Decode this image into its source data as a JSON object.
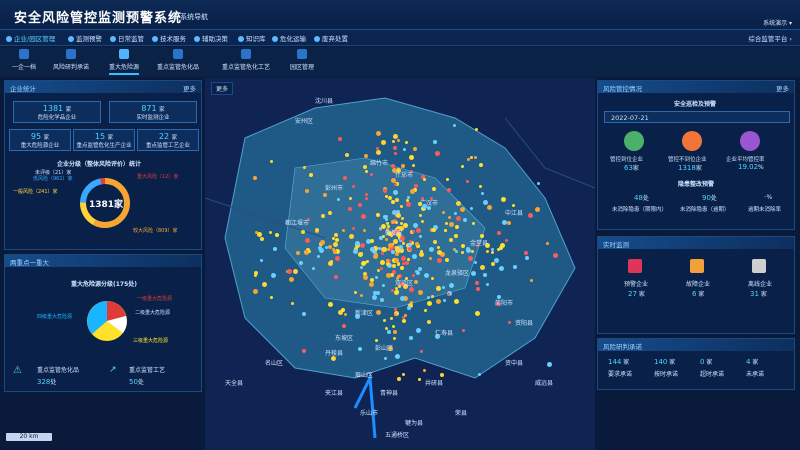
{
  "header": {
    "title": "安全风险管控监测预警系统",
    "nav": "系统导航",
    "user": "系统演示 ▾"
  },
  "menu": {
    "items": [
      "企业/园区管理",
      "监测预警",
      "日常监管",
      "技术服务",
      "辅助决策",
      "知识库",
      "危化运输",
      "废弃处置"
    ],
    "right": "综合监管平台 ›"
  },
  "tabs": [
    "一企一档",
    "风险研判承诺",
    "重大危险源",
    "重点监管危化品",
    "重点监管危化工艺",
    "园区管理"
  ],
  "left_top": {
    "title": "企业统计",
    "more": "更多",
    "stats": [
      {
        "n": "1381",
        "u": "家",
        "l": "危险化学品企业"
      },
      {
        "n": "871",
        "u": "家",
        "l": "实时监测企业"
      },
      {
        "n": "95",
        "u": "家",
        "l": "重大危险源企业"
      },
      {
        "n": "15",
        "u": "家",
        "l": "重点监管危化生产企业"
      },
      {
        "n": "22",
        "u": "家",
        "l": "重点监管工艺企业"
      }
    ],
    "chart_title": "企业分级（整体风险评价）统计",
    "center": "1381家",
    "legend": [
      "未评级（21）家",
      "低风险（961）家",
      "一般风险（241）家",
      "重大风险（12）家",
      "较大风险（809）家"
    ]
  },
  "left_bottom": {
    "title": "两重点一重大",
    "chart_title": "重大危险源分级(175处)",
    "legend": [
      "一级重大危险源",
      "二级重大危险源",
      "三级重大危险源",
      "四级重大危险源"
    ],
    "foot": [
      {
        "l": "重点监管危化品",
        "n": "328",
        "u": "处"
      },
      {
        "l": "重点监管工艺",
        "n": "50",
        "u": "处"
      }
    ]
  },
  "map": {
    "more": "更多",
    "scale": "20 km",
    "places": [
      "沈川县",
      "安州区",
      "绵竹市",
      "什邡市",
      "广汉市",
      "彭州市",
      "都江堰市",
      "新都区",
      "金堂县",
      "龙泉驿区",
      "简阳市",
      "双流区",
      "新津区",
      "仁寿县",
      "彭山区",
      "眉山区",
      "丹棱县",
      "青神县",
      "夹江县",
      "乐山市",
      "中江县",
      "资阳县",
      "资中县",
      "井研县",
      "荣县",
      "犍为县",
      "五通桥区",
      "威远县",
      "天全县",
      "名山区",
      "东坡区"
    ]
  },
  "right_top": {
    "title": "风险管控情况",
    "more": "更多",
    "sub": "安全巡检及预警",
    "date": "2022-07-21",
    "items": [
      {
        "l": "管控到位企业",
        "n": "63",
        "u": "家"
      },
      {
        "l": "管控不到位企业",
        "n": "1318",
        "u": "家"
      },
      {
        "l": "企业平均管控率",
        "n": "19.02",
        "u": "%"
      }
    ],
    "hidden_title": "隐患整改预警",
    "hidden": [
      {
        "n": "48",
        "u": "处",
        "l": "未消除隐患（期限内）"
      },
      {
        "n": "90",
        "u": "处",
        "l": "未消除隐患（逾期）"
      },
      {
        "n": "-",
        "u": "%",
        "l": "逾期未消除率"
      }
    ]
  },
  "right_mid": {
    "title": "实时监测",
    "items": [
      {
        "l": "预警企业",
        "n": "27",
        "u": "家"
      },
      {
        "l": "故障企业",
        "n": "6",
        "u": "家"
      },
      {
        "l": "离线企业",
        "n": "31",
        "u": "家"
      }
    ]
  },
  "right_bot": {
    "title": "风险研判承诺",
    "items": [
      {
        "n": "144",
        "u": "家",
        "l": "要求承诺"
      },
      {
        "n": "140",
        "u": "家",
        "l": "按时承诺"
      },
      {
        "n": "0",
        "u": "家",
        "l": "超时承诺"
      },
      {
        "n": "4",
        "u": "家",
        "l": "未承诺"
      }
    ]
  },
  "colors": {
    "accent": "#4fd3ff",
    "panel": "#0a224a"
  }
}
